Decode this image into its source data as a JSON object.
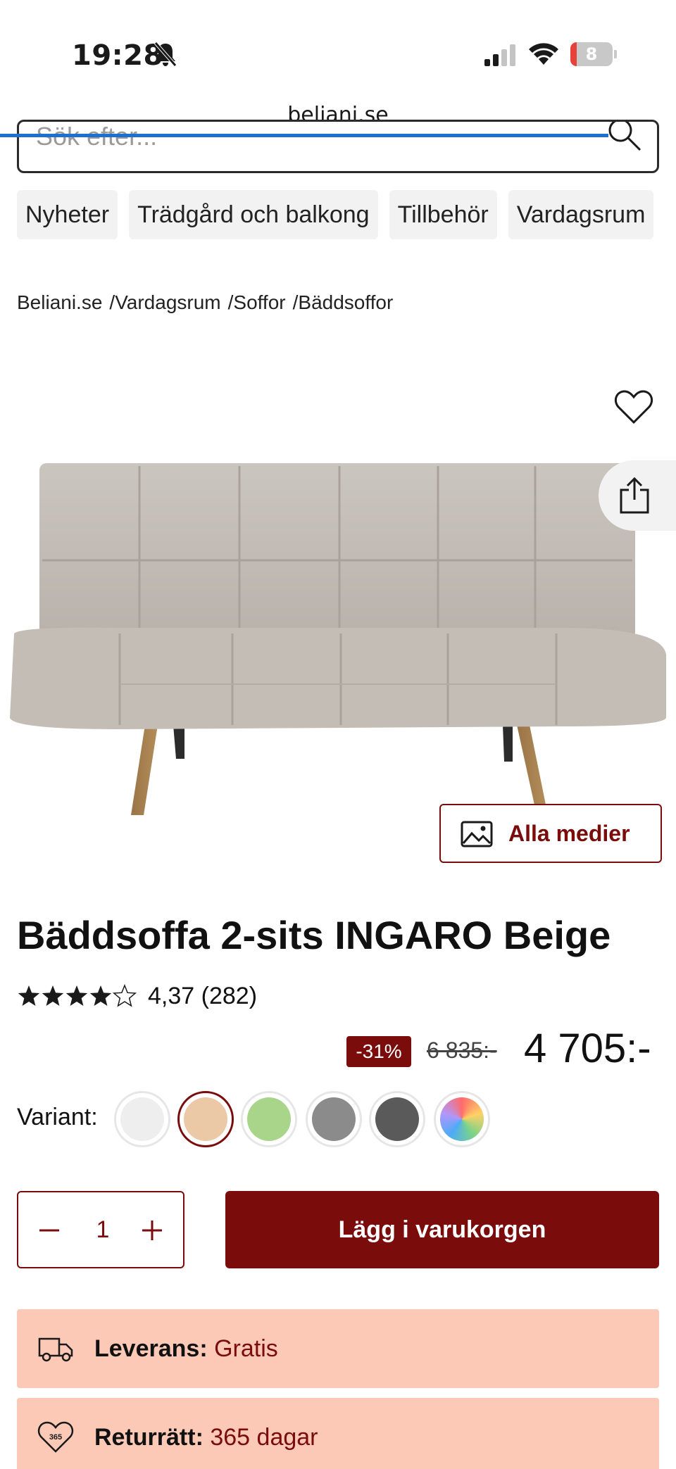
{
  "status_bar": {
    "time": "19:28",
    "battery_level": "8",
    "battery_fraction": 0.15
  },
  "browser": {
    "url": "beliani.se",
    "load_progress": 0.9
  },
  "search": {
    "placeholder": "Sök efter..."
  },
  "categories": [
    {
      "label": "Nyheter"
    },
    {
      "label": "Trädgård och balkong"
    },
    {
      "label": "Tillbehör"
    },
    {
      "label": "Vardagsrum"
    }
  ],
  "breadcrumb": [
    {
      "label": "Beliani.se"
    },
    {
      "label": "Vardagsrum"
    },
    {
      "label": "Soffor"
    },
    {
      "label": "Bäddsoffor"
    }
  ],
  "breadcrumb_separator": "/",
  "media_button": {
    "label": "Alla medier"
  },
  "product": {
    "title": "Bäddsoffa 2-sits INGARO Beige",
    "rating": "4,37",
    "reviews": "(282)",
    "rating_value": 4.37,
    "discount": "-31%",
    "old_price": "6 835:-",
    "price": "4 705:-"
  },
  "variants": {
    "label": "Variant:",
    "options": [
      {
        "color": "#eeeeee"
      },
      {
        "color": "#ebc9a6",
        "selected": true
      },
      {
        "color": "#a8d58a"
      },
      {
        "color": "#8b8b8b"
      },
      {
        "color": "#5a5a5a"
      },
      {
        "color": "rainbow"
      }
    ]
  },
  "quantity": {
    "value": "1"
  },
  "cart": {
    "label": "Lägg i varukorgen"
  },
  "info": [
    {
      "label": "Leverans:",
      "value": "Gratis",
      "icon": "truck-icon"
    },
    {
      "label": "Returrätt:",
      "value": "365 dagar",
      "icon": "return-heart-icon",
      "badge": "365"
    }
  ],
  "colors": {
    "brand": "#7a0c0c",
    "info_bg": "#fcc9b6",
    "load_bar": "#1f6fd1"
  }
}
